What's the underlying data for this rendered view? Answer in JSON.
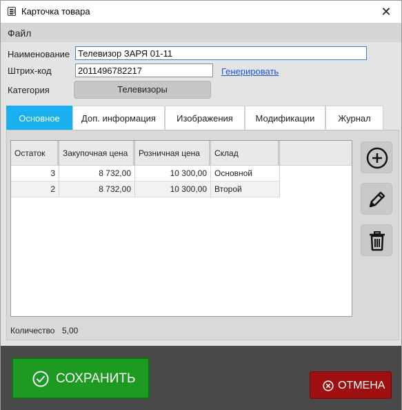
{
  "window": {
    "title": "Карточка товара",
    "close_glyph": "✕"
  },
  "menu": {
    "file": "Файл"
  },
  "form": {
    "name_label": "Наименование",
    "name_value": "Телевизор ЗАРЯ 01-11",
    "barcode_label": "Штрих-код",
    "barcode_value": "2011496782217",
    "generate_link": "Генерировать",
    "category_label": "Категория",
    "category_value": "Телевизоры"
  },
  "tabs": [
    {
      "label": "Основное",
      "active": true
    },
    {
      "label": "Доп. информация",
      "active": false
    },
    {
      "label": "Изображения",
      "active": false
    },
    {
      "label": "Модификации",
      "active": false
    },
    {
      "label": "Журнал",
      "active": false
    }
  ],
  "table": {
    "columns": [
      "Остаток",
      "Закупочная цена",
      "Розничная цена",
      "Склад"
    ],
    "rows": [
      [
        "3",
        "8 732,00",
        "10 300,00",
        "Основной"
      ],
      [
        "2",
        "8 732,00",
        "10 300,00",
        "Второй"
      ]
    ]
  },
  "side_actions": [
    {
      "icon": "add-circle-icon"
    },
    {
      "icon": "pencil-icon"
    },
    {
      "icon": "trash-icon"
    }
  ],
  "summary": {
    "qty_label": "Количество",
    "qty_value": "5,00"
  },
  "buttons": {
    "save": "СОХРАНИТЬ",
    "cancel": "ОТМЕНА"
  },
  "colors": {
    "active_tab": "#1ab0ef",
    "save": "#1c9a22",
    "cancel": "#a00f0f",
    "link": "#1a55d8"
  }
}
